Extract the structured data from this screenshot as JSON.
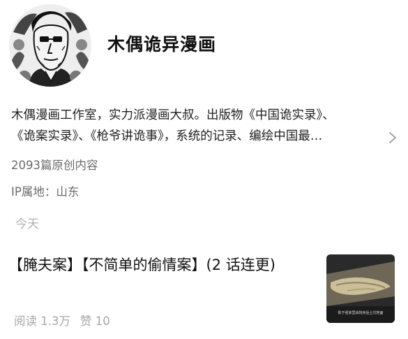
{
  "profile": {
    "name": "木偶诡异漫画",
    "avatar_icon": "avatar-portrait",
    "bio_line1": "木偶漫画工作室，实力派漫画大叔。出版物《中国诡实录》、",
    "bio_line2": "《诡案实录》、《枪爷讲诡事》，系统的记录、编绘中国最…",
    "original_count": "2093篇原创内容",
    "ip_location": "IP属地：山东"
  },
  "feed": {
    "date_label": "今天",
    "articles": [
      {
        "title": "【腌夫案】【不简单的偷情案】(2 话连更)",
        "reads": "阅读 1.3万",
        "likes": "赞 10",
        "thumbnail_caption": "陈于强家里由院身后土坑地面"
      }
    ]
  },
  "colors": {
    "text_primary": "#111111",
    "text_secondary": "#6b6b6b",
    "text_muted": "#b0b0b0",
    "background": "#ffffff"
  }
}
